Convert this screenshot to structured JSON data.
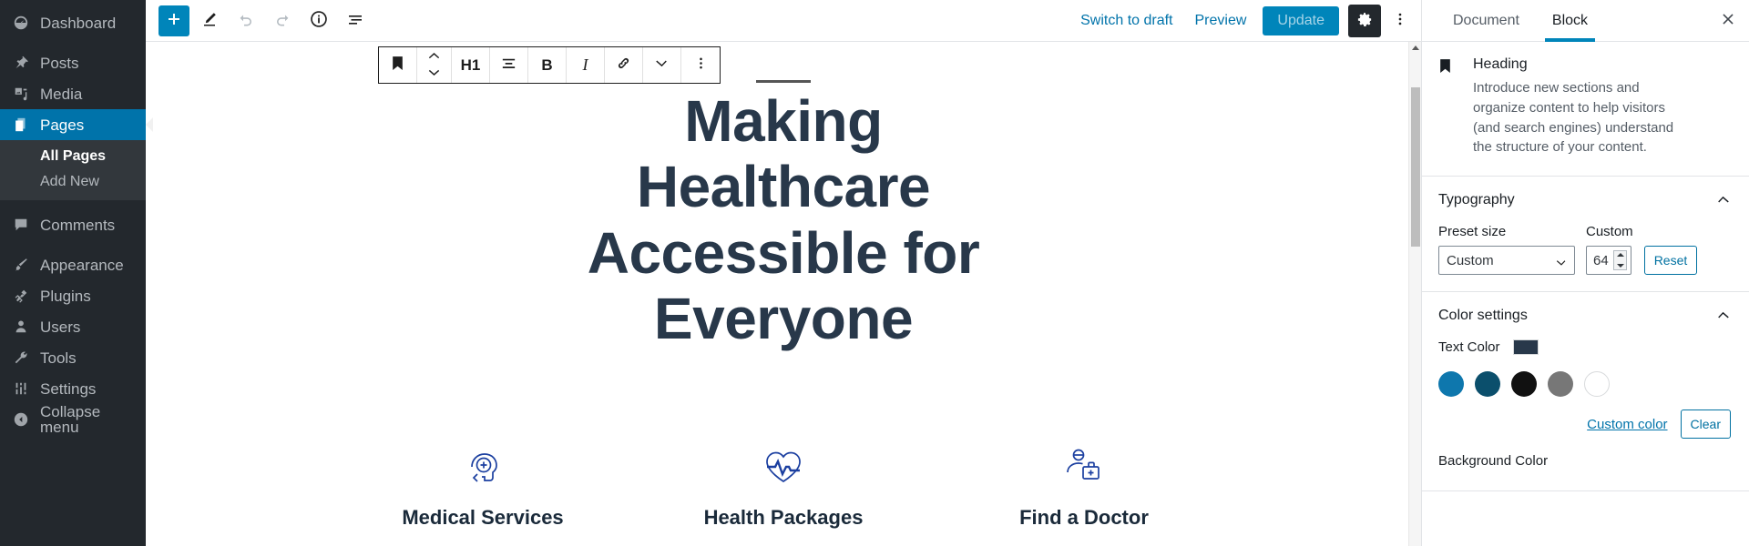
{
  "admin_menu": {
    "items": [
      {
        "label": "Dashboard",
        "icon": "dashboard-icon",
        "active": false
      },
      {
        "label": "Posts",
        "icon": "pin-icon",
        "active": false
      },
      {
        "label": "Media",
        "icon": "media-icon",
        "active": false
      },
      {
        "label": "Pages",
        "icon": "pages-icon",
        "active": true
      },
      {
        "label": "Comments",
        "icon": "comments-icon",
        "active": false
      },
      {
        "label": "Appearance",
        "icon": "brush-icon",
        "active": false
      },
      {
        "label": "Plugins",
        "icon": "plug-icon",
        "active": false
      },
      {
        "label": "Users",
        "icon": "user-icon",
        "active": false
      },
      {
        "label": "Tools",
        "icon": "wrench-icon",
        "active": false
      },
      {
        "label": "Settings",
        "icon": "sliders-icon",
        "active": false
      }
    ],
    "submenu": [
      {
        "label": "All Pages",
        "current": true
      },
      {
        "label": "Add New",
        "current": false
      }
    ],
    "collapse_label": "Collapse menu"
  },
  "header": {
    "add_block_label": "+",
    "tools": [
      {
        "name": "add-block-button",
        "icon": "plus-icon"
      },
      {
        "name": "edit-mode-button",
        "icon": "pencil-icon"
      },
      {
        "name": "undo-button",
        "icon": "undo-icon"
      },
      {
        "name": "redo-button",
        "icon": "redo-icon"
      },
      {
        "name": "details-button",
        "icon": "info-icon"
      },
      {
        "name": "list-view-button",
        "icon": "list-view-icon"
      }
    ],
    "switch_to_draft": "Switch to draft",
    "preview": "Preview",
    "update": "Update",
    "settings_icon": "gear-icon",
    "more_icon": "ellipsis-vertical-icon"
  },
  "block_toolbar": {
    "items": [
      {
        "name": "block-type-heading-button",
        "icon": "heading-bookmark-icon",
        "label": ""
      },
      {
        "name": "move-block-button",
        "icon": "move-up-down-icon",
        "label": ""
      },
      {
        "name": "heading-level-button",
        "icon": "",
        "label": "H1"
      },
      {
        "name": "text-align-button",
        "icon": "align-center-icon",
        "label": ""
      },
      {
        "name": "bold-button",
        "icon": "",
        "label": "B"
      },
      {
        "name": "italic-button",
        "icon": "",
        "label": "I"
      },
      {
        "name": "link-button",
        "icon": "link-icon",
        "label": ""
      },
      {
        "name": "more-rich-text-button",
        "icon": "chevron-down-icon",
        "label": ""
      },
      {
        "name": "block-options-button",
        "icon": "ellipsis-vertical-icon",
        "label": ""
      }
    ]
  },
  "content": {
    "heading": "Making Healthcare Accessible for Everyone",
    "heading_color": "#28384a",
    "features": [
      {
        "label": "Medical Services",
        "icon": "head-medical-cross-icon"
      },
      {
        "label": "Health Packages",
        "icon": "heart-pulse-icon"
      },
      {
        "label": "Find a Doctor",
        "icon": "doctor-medical-kit-icon"
      }
    ],
    "feature_icon_color": "#1b3fa0"
  },
  "settings_sidebar": {
    "tabs": [
      {
        "label": "Document",
        "active": false
      },
      {
        "label": "Block",
        "active": true
      }
    ],
    "close_icon": "close-icon",
    "block_info": {
      "icon": "heading-bookmark-icon",
      "title": "Heading",
      "description": "Introduce new sections and organize content to help visitors (and search engines) understand the structure of your content."
    },
    "typography": {
      "panel_title": "Typography",
      "preset_label": "Preset size",
      "preset_value": "Custom",
      "custom_label": "Custom",
      "custom_value": "64",
      "reset_label": "Reset"
    },
    "color_settings": {
      "panel_title": "Color settings",
      "text_color_label": "Text Color",
      "text_color_value": "#28384a",
      "palette": [
        "#0e77ad",
        "#0b4f6c",
        "#111111",
        "#777777",
        "#ffffff"
      ],
      "custom_color_label": "Custom color",
      "clear_label": "Clear",
      "background_color_label": "Background Color"
    }
  }
}
